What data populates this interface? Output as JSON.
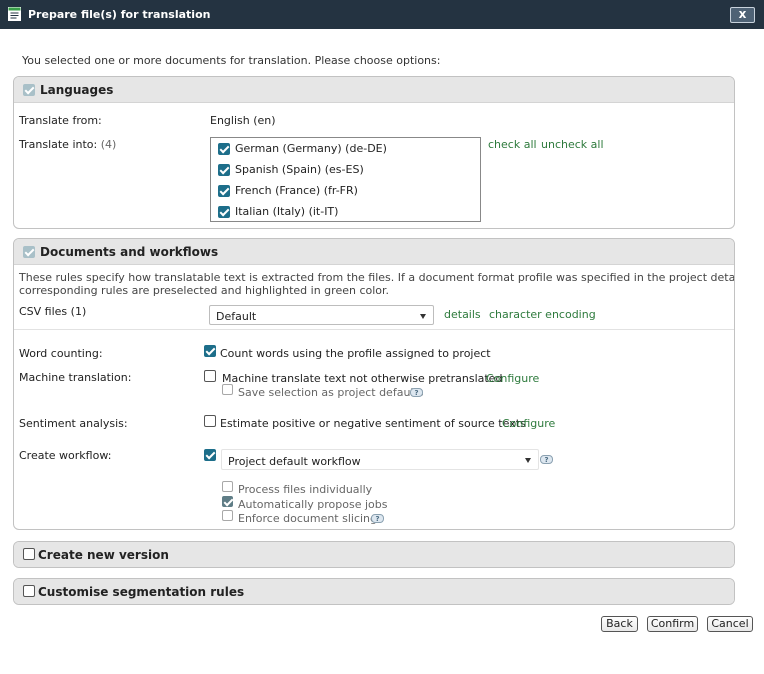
{
  "window": {
    "title": "Prepare file(s) for translation",
    "close_label": "x"
  },
  "intro": "You selected one or more documents for translation. Please choose options:",
  "languages": {
    "title": "Languages",
    "translate_from_label": "Translate from:",
    "translate_from_value": "English (en)",
    "translate_into_label": "Translate into:",
    "translate_into_count": "(4)",
    "targets": [
      {
        "label": "German (Germany) (de-DE)",
        "checked": true
      },
      {
        "label": "Spanish (Spain) (es-ES)",
        "checked": true
      },
      {
        "label": "French (France) (fr-FR)",
        "checked": true
      },
      {
        "label": "Italian (Italy) (it-IT)",
        "checked": true
      }
    ],
    "check_all": "check all",
    "uncheck_all": "uncheck all"
  },
  "documents": {
    "title": "Documents and workflows",
    "description_line1": "These rules specify how translatable text is extracted from the files. If a document format profile was specified in the project details, then the",
    "description_line2": "corresponding rules are preselected and highlighted in green color.",
    "csv_label": "CSV files (1)",
    "csv_select_value": "Default",
    "details_link": "details",
    "encoding_link": "character encoding",
    "word_counting_label": "Word counting:",
    "word_counting_option": "Count words using the profile assigned to project",
    "mt_label": "Machine translation:",
    "mt_option": "Machine translate text not otherwise pretranslated",
    "mt_configure": "Configure",
    "mt_save_defaults": "Save selection as project defaults",
    "sentiment_label": "Sentiment analysis:",
    "sentiment_option": "Estimate positive or negative sentiment of source texts",
    "sentiment_configure": "Configure",
    "workflow_label": "Create workflow:",
    "workflow_select_value": "Project default workflow",
    "process_individually": "Process files individually",
    "auto_propose": "Automatically propose jobs",
    "enforce_slicing": "Enforce document slicing."
  },
  "new_version": {
    "title": "Create new version"
  },
  "segmentation": {
    "title": "Customise segmentation rules"
  },
  "buttons": {
    "back": "Back",
    "confirm": "Confirm",
    "cancel": "Cancel"
  },
  "help_glyph": "?",
  "colors": {
    "titlebar": "#243341",
    "checkbox": "#1d6e8a",
    "link": "#2d7a3c",
    "section_header": "#e6e6e6"
  },
  "icons": {
    "window": "document-icon",
    "close": "close-icon",
    "help": "help-icon",
    "dropdown": "chevron-down-icon"
  }
}
